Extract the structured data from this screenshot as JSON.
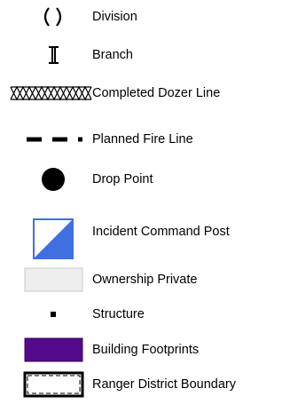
{
  "legend": {
    "items": [
      {
        "icon": "division-symbol-icon",
        "label": "Division"
      },
      {
        "icon": "branch-symbol-icon",
        "label": "Branch"
      },
      {
        "icon": "completed-dozer-line-icon",
        "label": "Completed Dozer Line"
      },
      {
        "icon": "planned-fire-line-icon",
        "label": "Planned Fire Line"
      },
      {
        "icon": "drop-point-icon",
        "label": "Drop Point"
      },
      {
        "icon": "incident-command-post-icon",
        "label": "Incident Command Post",
        "color": "#3f6fe0"
      },
      {
        "icon": "ownership-private-swatch",
        "label": "Ownership Private",
        "color": "#eeeeee"
      },
      {
        "icon": "structure-icon",
        "label": "Structure"
      },
      {
        "icon": "building-footprints-swatch",
        "label": "Building Footprints",
        "color": "#540a8a"
      },
      {
        "icon": "ranger-district-boundary-icon",
        "label": "Ranger District Boundary"
      }
    ]
  }
}
